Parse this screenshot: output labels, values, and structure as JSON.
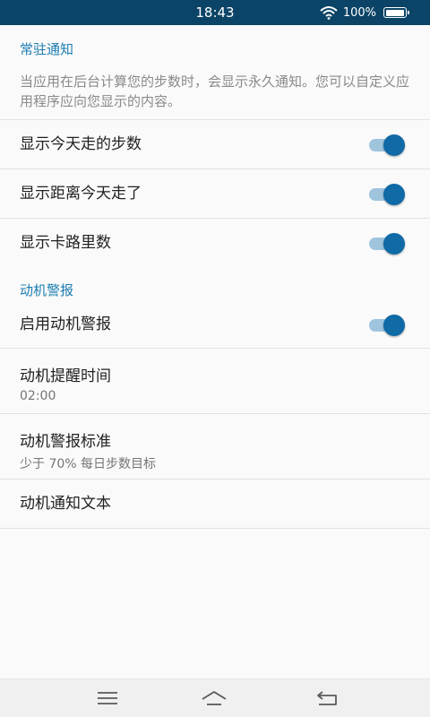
{
  "status_bar": {
    "time": "18:43",
    "battery_text": "100%",
    "battery_level": 1.0,
    "wifi_icon": "wifi-icon",
    "battery_icon": "battery-icon"
  },
  "notification_section": {
    "header": "常驻通知",
    "description": "当应用在后台计算您的步数时，会显示永久通知。您可以自定义应用程序应向您显示的内容。",
    "items": [
      {
        "label": "显示今天走的步数",
        "enabled": true
      },
      {
        "label": "显示距离今天走了",
        "enabled": true
      },
      {
        "label": "显示卡路里数",
        "enabled": true
      }
    ]
  },
  "motivation_section": {
    "header": "动机警报",
    "enable": {
      "label": "启用动机警报",
      "enabled": true
    },
    "reminder_time": {
      "label": "动机提醒时间",
      "value": "02:00"
    },
    "criteria": {
      "label": "动机警报标准",
      "value": "少于 70% 每日步数目标"
    },
    "notification_text": {
      "label": "动机通知文本"
    }
  },
  "navigation_bar": {
    "menu_icon": "menu-icon",
    "home_icon": "home-icon",
    "back_icon": "back-icon"
  },
  "colors": {
    "status_bar": "#0b4466",
    "accent": "#1c7db0",
    "toggle_knob": "#0f6aa6",
    "toggle_track": "#9ec4de",
    "background": "#fafafa"
  }
}
